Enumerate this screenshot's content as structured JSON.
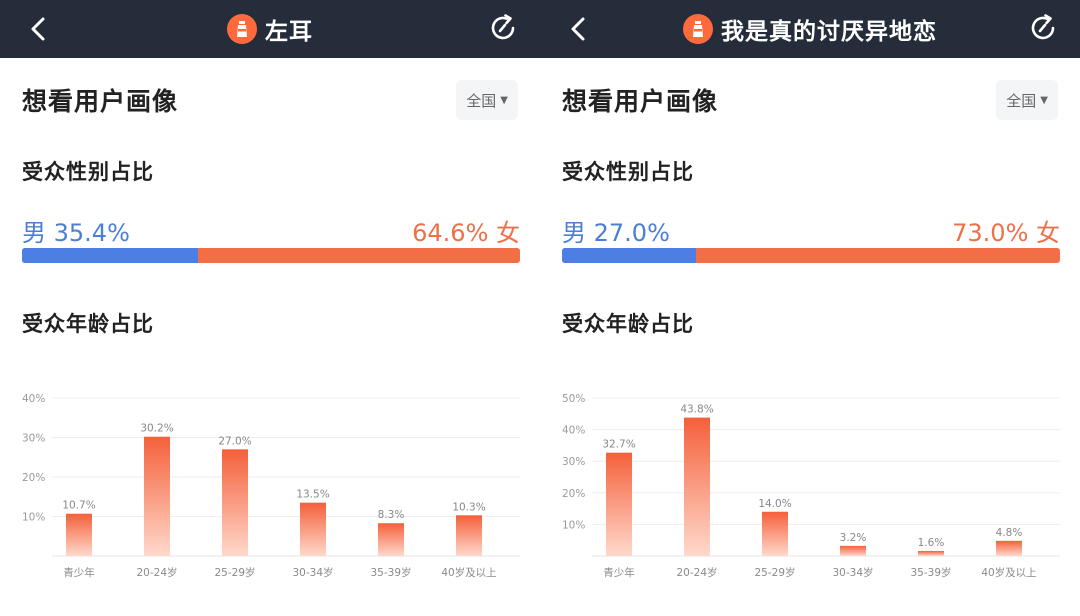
{
  "colors": {
    "header_bg": "#252d3a",
    "male": "#4d7ee3",
    "female": "#f36d47",
    "bar_top": "#f4603a",
    "bar_bottom": "#ffd9cc",
    "logo": "#ff6a3d"
  },
  "icons": {
    "back": "chevron-left-icon",
    "refresh": "refresh-icon",
    "logo": "lighthouse-logo-icon",
    "region_caret": "caret-down-icon"
  },
  "panels": [
    {
      "header": {
        "title": "左耳"
      },
      "section_title": "想看用户画像",
      "region": {
        "label": "全国",
        "caret": "▼"
      },
      "gender": {
        "title": "受众性别占比",
        "male_label": "男 35.4%",
        "female_label": "64.6% 女",
        "male_percent": 35.4,
        "female_percent": 64.6
      },
      "age_title": "受众年龄占比",
      "chart_data": {
        "type": "bar",
        "categories": [
          "青少年",
          "20-24岁",
          "25-29岁",
          "30-34岁",
          "35-39岁",
          "40岁及以上"
        ],
        "values": [
          10.7,
          30.2,
          27.0,
          13.5,
          8.3,
          10.3
        ],
        "value_labels": [
          "10.7%",
          "30.2%",
          "27.0%",
          "13.5%",
          "8.3%",
          "10.3%"
        ],
        "ylim": [
          0,
          40
        ],
        "yticks": [
          10,
          20,
          30,
          40
        ],
        "ytick_labels": [
          "10%",
          "20%",
          "30%",
          "40%"
        ],
        "grid": true
      }
    },
    {
      "header": {
        "title": "我是真的讨厌异地恋"
      },
      "section_title": "想看用户画像",
      "region": {
        "label": "全国",
        "caret": "▼"
      },
      "gender": {
        "title": "受众性别占比",
        "male_label": "男 27.0%",
        "female_label": "73.0% 女",
        "male_percent": 27.0,
        "female_percent": 73.0
      },
      "age_title": "受众年龄占比",
      "chart_data": {
        "type": "bar",
        "categories": [
          "青少年",
          "20-24岁",
          "25-29岁",
          "30-34岁",
          "35-39岁",
          "40岁及以上"
        ],
        "values": [
          32.7,
          43.8,
          14.0,
          3.2,
          1.6,
          4.8
        ],
        "value_labels": [
          "32.7%",
          "43.8%",
          "14.0%",
          "3.2%",
          "1.6%",
          "4.8%"
        ],
        "ylim": [
          0,
          50
        ],
        "yticks": [
          10,
          20,
          30,
          40,
          50
        ],
        "ytick_labels": [
          "10%",
          "20%",
          "30%",
          "40%",
          "50%"
        ],
        "grid": true
      }
    }
  ]
}
